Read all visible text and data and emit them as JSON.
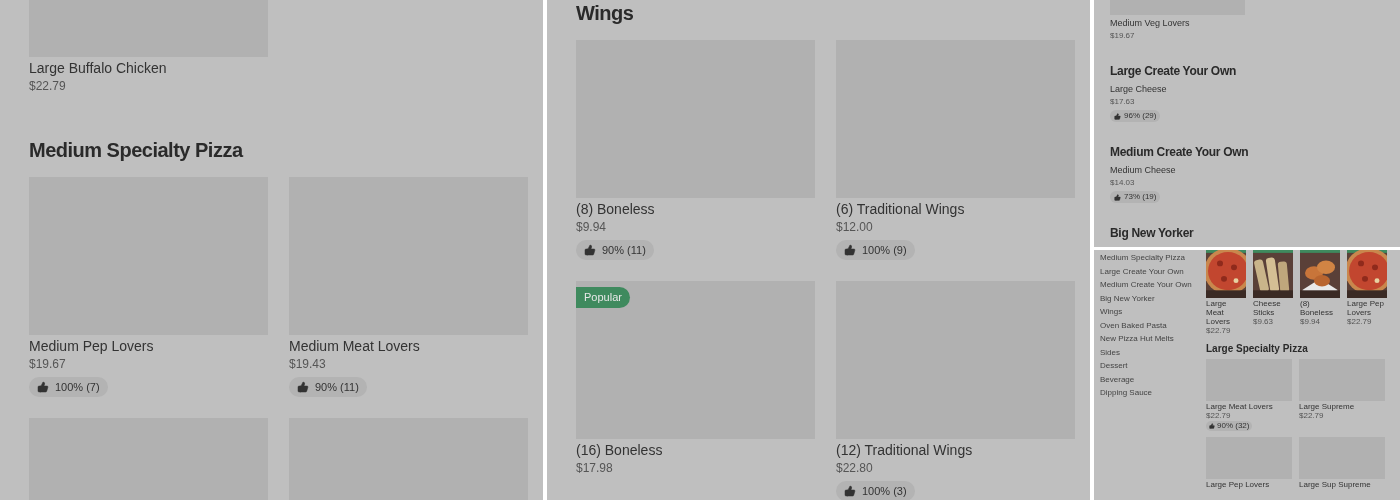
{
  "panels": [
    {
      "kind": "menu_large",
      "sections": [
        {
          "cropped": true,
          "items": [
            {
              "kind": "card",
              "name": "Large Buffalo Chicken",
              "price": "$22.79"
            }
          ]
        },
        {
          "heading": "Medium Specialty Pizza",
          "items": [
            {
              "kind": "card",
              "name": "Medium Pep Lovers",
              "price": "$19.67",
              "rating": "100% (7)"
            },
            {
              "kind": "card",
              "name": "Medium Meat Lovers",
              "price": "$19.43",
              "rating": "90% (11)"
            },
            {
              "kind": "placeholder"
            },
            {
              "kind": "placeholder"
            }
          ]
        }
      ]
    },
    {
      "kind": "menu_large",
      "sections": [
        {
          "heading": "Wings",
          "items": [
            {
              "kind": "card",
              "name": "(8) Boneless",
              "price": "$9.94",
              "rating": "90% (11)"
            },
            {
              "kind": "card",
              "name": "(6) Traditional Wings",
              "price": "$12.00",
              "rating": "100% (9)"
            },
            {
              "kind": "card",
              "name": "(16) Boneless",
              "price": "$17.98",
              "badge": "Popular"
            },
            {
              "kind": "card",
              "name": "(12) Traditional Wings",
              "price": "$22.80",
              "rating": "100% (3)"
            }
          ]
        }
      ]
    },
    {
      "kind": "menu_small",
      "sections": [
        {
          "cropped": true,
          "items": [
            {
              "kind": "card",
              "name": "Medium Veg Lovers",
              "price": "$19.67"
            }
          ]
        },
        {
          "heading": "Large Create Your Own",
          "items": [
            {
              "kind": "card",
              "name": "Large Cheese",
              "price": "$17.63",
              "rating": "96% (29)"
            }
          ]
        },
        {
          "heading": "Medium Create Your Own",
          "items": [
            {
              "kind": "card",
              "name": "Medium Cheese",
              "price": "$14.03",
              "rating": "73% (19)"
            }
          ]
        },
        {
          "heading": "Big New Yorker"
        }
      ]
    },
    {
      "kind": "sidebar_menu",
      "sidebar": [
        "Medium Specialty Pizza",
        "Large Create Your Own",
        "Medium Create Your Own",
        "Big New Yorker",
        "Wings",
        "Oven Baked Pasta",
        "New Pizza Hut Melts",
        "Sides",
        "Dessert",
        "Beverage",
        "Dipping Sauce"
      ],
      "popular_items": [
        {
          "name": "Large Meat Lovers",
          "price": "$22.79"
        },
        {
          "name": "Cheese Sticks",
          "price": "$9.63"
        },
        {
          "name": "(8) Boneless",
          "price": "$9.94"
        },
        {
          "name": "Large Pep Lovers",
          "price": "$22.79"
        }
      ],
      "sections": [
        {
          "heading": "Large Specialty Pizza",
          "items": [
            {
              "kind": "card",
              "name": "Large Meat Lovers",
              "price": "$22.79",
              "rating": "90% (32)"
            },
            {
              "kind": "card",
              "name": "Large Supreme",
              "price": "$22.79"
            },
            {
              "kind": "card",
              "name": "Large Pep Lovers"
            },
            {
              "kind": "card",
              "name": "Large Sup Supreme"
            }
          ]
        }
      ]
    }
  ]
}
